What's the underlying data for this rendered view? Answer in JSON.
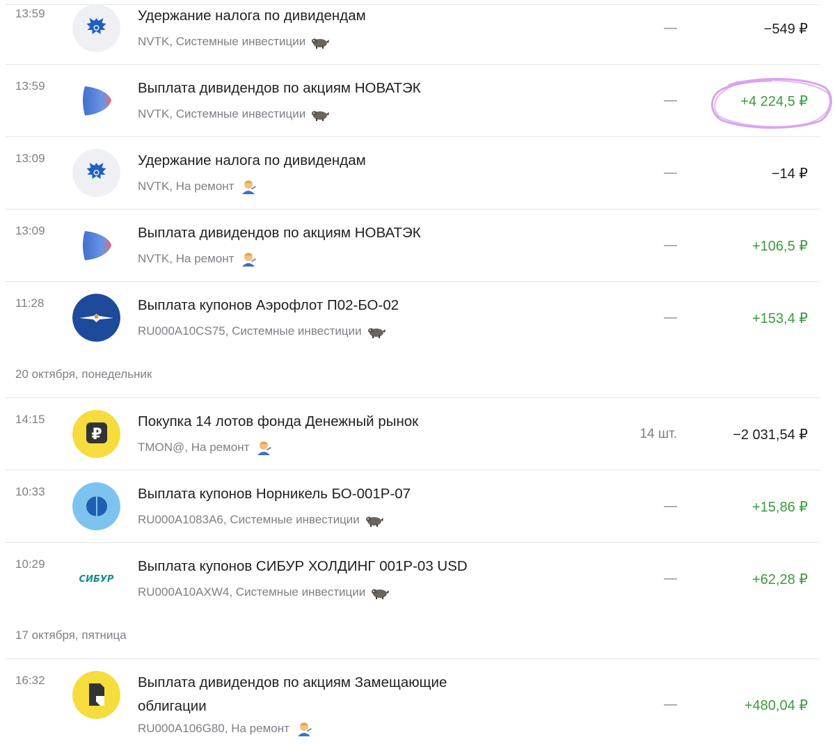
{
  "colors": {
    "positive": "#3b9b3b",
    "negative": "#1f1f1f",
    "muted": "#7d8086",
    "highlight": "#d9a3f0"
  },
  "operations": [
    {
      "time": "13:59",
      "title": "Удержание налога по дивидендам",
      "subtitle": "NVTK, Системные инвестиции",
      "portfolio_icon": "raccoon-icon",
      "qty": "—",
      "amount": "−549 ₽",
      "sign": "neg",
      "logo": "gov-eagle-logo"
    },
    {
      "time": "13:59",
      "title": "Выплата дивидендов по акциям НОВАТЭК",
      "subtitle": "NVTK, Системные инвестиции",
      "portfolio_icon": "raccoon-icon",
      "qty": "—",
      "amount": "+4 224,5 ₽",
      "sign": "pos",
      "logo": "novatek-logo"
    },
    {
      "time": "13:09",
      "title": "Удержание налога по дивидендам",
      "subtitle": "NVTK, На ремонт",
      "portfolio_icon": "repairman-icon",
      "qty": "—",
      "amount": "−14 ₽",
      "sign": "neg",
      "logo": "gov-eagle-logo"
    },
    {
      "time": "13:09",
      "title": "Выплата дивидендов по акциям НОВАТЭК",
      "subtitle": "NVTK, На ремонт",
      "portfolio_icon": "repairman-icon",
      "qty": "—",
      "amount": "+106,5 ₽",
      "sign": "pos",
      "logo": "novatek-logo"
    },
    {
      "time": "11:28",
      "title": "Выплата купонов Аэрофлот П02-БО-02",
      "subtitle": "RU000A10CS75, Системные инвестиции",
      "portfolio_icon": "raccoon-icon",
      "qty": "—",
      "amount": "+153,4 ₽",
      "sign": "pos",
      "logo": "aeroflot-logo"
    },
    {
      "date_header": "20 октября, понедельник"
    },
    {
      "time": "14:15",
      "title": "Покупка 14 лотов фонда Денежный рынок",
      "subtitle": "TMON@, На ремонт",
      "portfolio_icon": "repairman-icon",
      "qty": "14 шт.",
      "amount": "−2 031,54 ₽",
      "sign": "neg",
      "logo": "tmon-ruble-logo"
    },
    {
      "time": "10:33",
      "title": "Выплата купонов Норникель БО-001Р-07",
      "subtitle": "RU000A1083A6, Системные инвестиции",
      "portfolio_icon": "raccoon-icon",
      "qty": "—",
      "amount": "+15,86 ₽",
      "sign": "pos",
      "logo": "nornickel-logo"
    },
    {
      "time": "10:29",
      "title": "Выплата купонов СИБУР ХОЛДИНГ 001Р-03 USD",
      "subtitle": "RU000A10AXW4, Системные инвестиции",
      "portfolio_icon": "raccoon-icon",
      "qty": "—",
      "amount": "+62,28 ₽",
      "sign": "pos",
      "logo": "sibur-logo",
      "logo_text": "СИБУР"
    },
    {
      "date_header": "17 октября, пятница"
    },
    {
      "time": "16:32",
      "title": "Выплата дивидендов по акциям Замещающие облигации",
      "subtitle": "RU000A106G80, На ремонт",
      "portfolio_icon": "repairman-icon",
      "qty": "—",
      "amount": "+480,04 ₽",
      "sign": "pos",
      "logo": "replacement-bonds-logo"
    }
  ]
}
